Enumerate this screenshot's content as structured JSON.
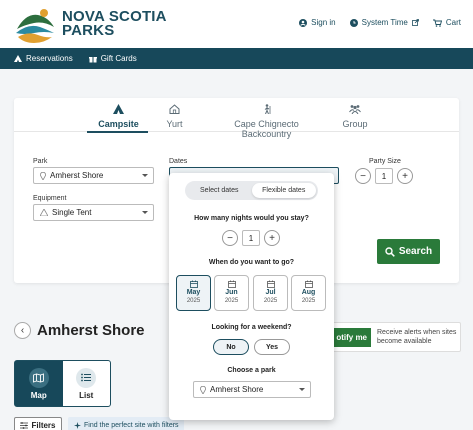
{
  "header": {
    "brand_line1": "NOVA SCOTIA",
    "brand_line2": "PARKS",
    "sign_in": "Sign in",
    "system_time": "System Time",
    "cart": "Cart"
  },
  "nav": {
    "reservations": "Reservations",
    "gift_cards": "Gift Cards"
  },
  "search": {
    "tabs": [
      {
        "label": "Campsite",
        "icon": "tent-icon"
      },
      {
        "label": "Yurt",
        "icon": "yurt-icon"
      },
      {
        "label": "Cape Chignecto Backcountry",
        "icon": "hiker-icon"
      },
      {
        "label": "Group",
        "icon": "group-icon"
      }
    ],
    "park_label": "Park",
    "park_value": "Amherst Shore",
    "dates_label": "Dates",
    "party_label": "Party Size",
    "party_value": "1",
    "equipment_label": "Equipment",
    "equipment_value": "Single Tent",
    "search_button": "Search"
  },
  "popup": {
    "select_dates": "Select dates",
    "flexible_dates": "Flexible dates",
    "nights_question": "How many nights would you stay?",
    "nights_value": "1",
    "when_question": "When do you want to go?",
    "months": [
      {
        "name": "May",
        "year": "2025",
        "selected": true
      },
      {
        "name": "Jun",
        "year": "2025",
        "selected": false
      },
      {
        "name": "Jul",
        "year": "2025",
        "selected": false
      },
      {
        "name": "Aug",
        "year": "2025",
        "selected": false
      }
    ],
    "weekend_question": "Looking for a weekend?",
    "weekend_no": "No",
    "weekend_yes": "Yes",
    "choose_park": "Choose a park",
    "choose_park_value": "Amherst Shore"
  },
  "results": {
    "park_name": "Amherst Shore",
    "notify_button": "otify me",
    "notify_text": "Receive alerts when sites become available",
    "map_label": "Map",
    "list_label": "List",
    "filters_label": "Filters",
    "find_hint": "Find the perfect site with filters"
  },
  "colors": {
    "brand_dark": "#17485a",
    "accent_green": "#2a7a3a"
  }
}
